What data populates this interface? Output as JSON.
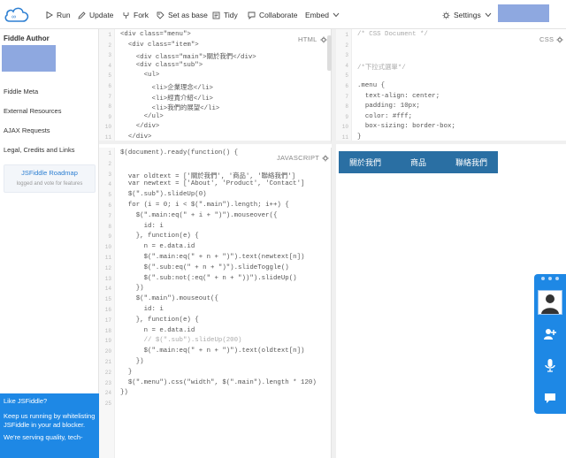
{
  "toolbar": {
    "run_label": "Run",
    "update_label": "Update",
    "fork_label": "Fork",
    "set_base_label": "Set as base",
    "tidy_label": "Tidy",
    "collaborate_label": "Collaborate",
    "embed_label": "Embed",
    "settings_label": "Settings"
  },
  "sidebar": {
    "title": "Fiddle Author",
    "links": [
      "Fiddle Meta",
      "External Resources",
      "AJAX Requests",
      "Legal, Credits and Links"
    ],
    "roadmap_title": "JSFiddle Roadmap",
    "roadmap_sub": "logged and vote for features",
    "ad_title": "Like JSFiddle?",
    "ad_body": "Keep us running by whitelisting JSFiddle in your ad blocker.",
    "ad_more": "We're serving quality, tech-"
  },
  "panels": {
    "html_label": "HTML",
    "css_label": "CSS",
    "js_label": "JAVASCRIPT"
  },
  "html_code": [
    "<div class=\"menu\">",
    "  <div class=\"item\">",
    "    <div class=\"main\">關於我們</div>",
    "    <div class=\"sub\">",
    "      <ul>",
    "        <li>企業理念</li>",
    "        <li>經責介紹</li>",
    "        <li>我們的展望</li>",
    "      </ul>",
    "    </div>",
    "  </div>"
  ],
  "css_code": [
    "/* CSS Document */",
    "",
    "",
    "/*下拉式選單*/",
    "",
    ".menu {",
    "  text-align: center;",
    "  padding: 10px;",
    "  color: #fff;",
    "  box-sizing: border-box;",
    "}"
  ],
  "js_code": [
    "$(document).ready(function() {",
    "",
    "  var oldtext = ['關於我們', '商品', '聯絡我們']",
    "  var newtext = ['About', 'Product', 'Contact']",
    "  $(\".sub\").slideUp(0)",
    "  for (i = 0; i < $(\".main\").length; i++) {",
    "    $(\".main:eq(\" + i + \")\").mouseover({",
    "      id: i",
    "    }, function(e) {",
    "      n = e.data.id",
    "      $(\".main:eq(\" + n + \")\").text(newtext[n])",
    "      $(\".sub:eq(\" + n + \")\").slideToggle()",
    "      $(\".sub:not(:eq(\" + n + \"))\").slideUp()",
    "    })",
    "    $(\".main\").mouseout({",
    "      id: i",
    "    }, function(e) {",
    "      n = e.data.id",
    "      // $(\".sub\").slideUp(200)",
    "      $(\".main:eq(\" + n + \")\").text(oldtext[n])",
    "    })",
    "  }",
    "  $(\".menu\").css(\"width\", $(\".main\").length * 120)",
    "})",
    ""
  ],
  "html_line_numbers": [
    "1",
    "2",
    "3",
    "4",
    "5",
    "6",
    "7",
    "8",
    "9",
    "10",
    "11"
  ],
  "css_line_numbers": [
    "1",
    "2",
    "3",
    "4",
    "5",
    "6",
    "7",
    "8",
    "9",
    "10",
    "11"
  ],
  "js_line_numbers": [
    "1",
    "2",
    "3",
    "4",
    "5",
    "6",
    "7",
    "8",
    "9",
    "10",
    "11",
    "12",
    "13",
    "14",
    "15",
    "16",
    "17",
    "18",
    "19",
    "20",
    "21",
    "22",
    "23",
    "24",
    "25"
  ],
  "result": {
    "menu_items": [
      "關於我們",
      "商品",
      "聯絡我們"
    ]
  },
  "colors": {
    "accent": "#1e88e5",
    "menu_bg": "#2a6fa3"
  }
}
